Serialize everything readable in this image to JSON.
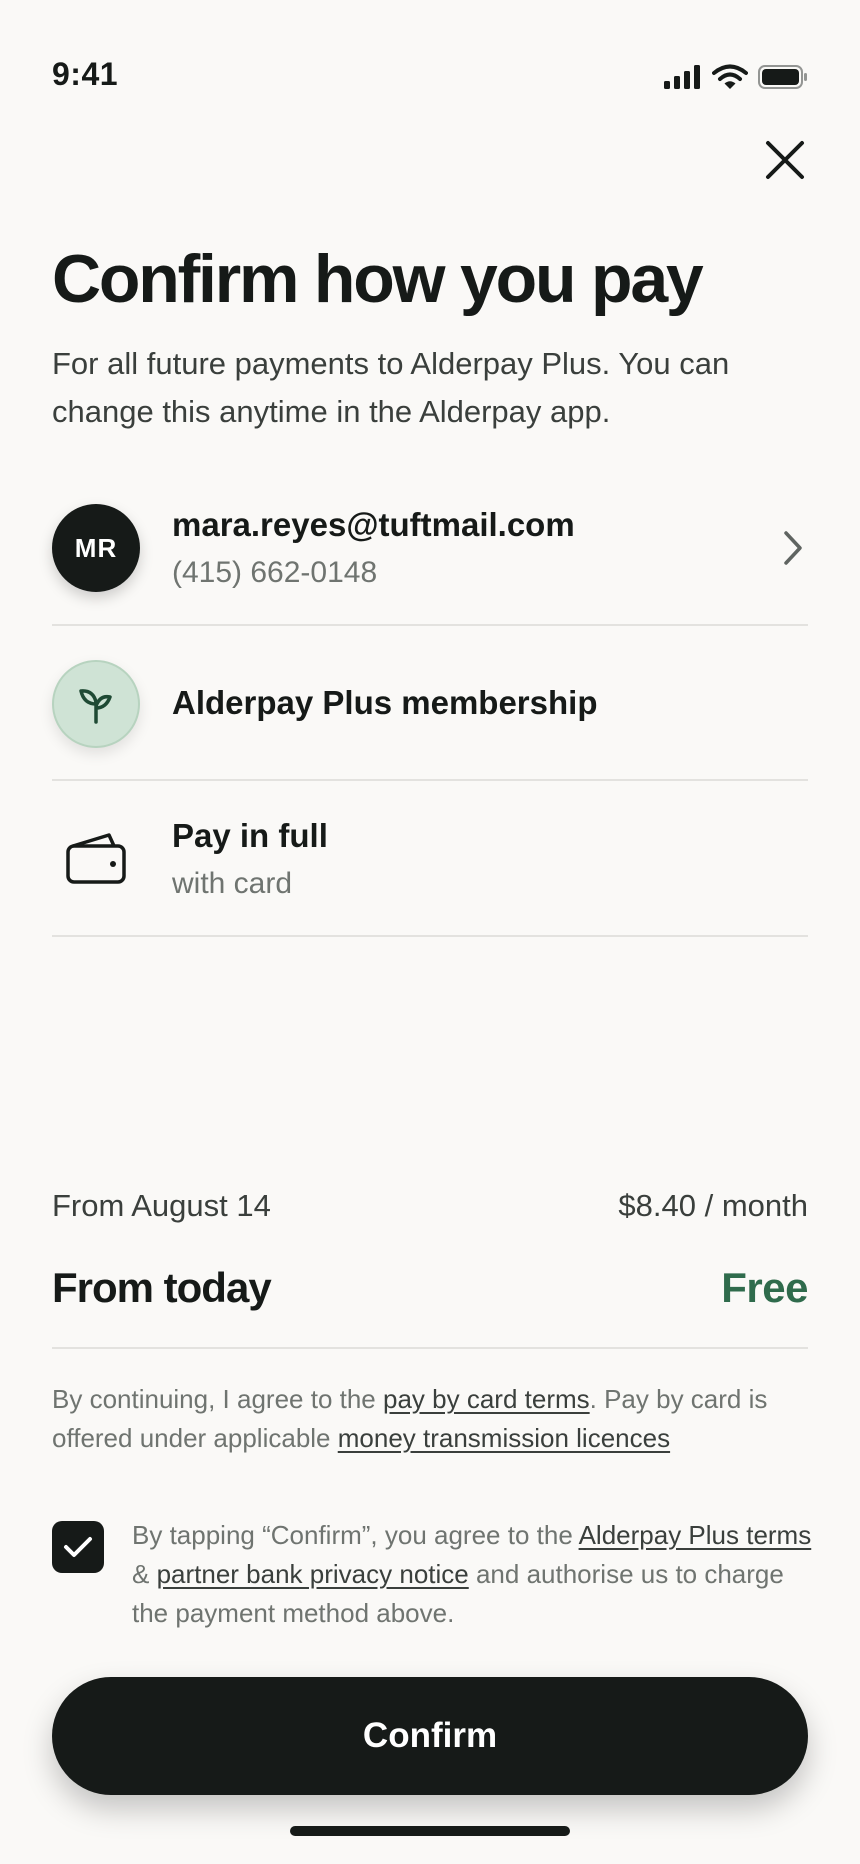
{
  "status_bar": {
    "time": "9:41"
  },
  "header": {
    "title": "Confirm how you pay",
    "subtitle": "For all future payments to Alderpay Plus. You can change this anytime in the Alderpay app."
  },
  "account": {
    "initials": "MR",
    "email": "mara.reyes@tuftmail.com",
    "phone": "(415) 662-0148"
  },
  "membership": {
    "label": "Alderpay Plus membership"
  },
  "payment_method": {
    "title": "Pay in full",
    "subtitle": "with card"
  },
  "pricing": {
    "future_label": "From August 14",
    "future_price": "$8.40 / month",
    "today_label": "From today",
    "today_price": "Free"
  },
  "legal": {
    "part1": "By continuing, I agree to the ",
    "link1": "pay by card terms",
    "part2": ". Pay by card is offered under applicable ",
    "link2": "money transmission licences"
  },
  "consent": {
    "checked": true,
    "part1": "By tapping “Confirm”, you agree to the ",
    "link1": "Alderpay Plus terms",
    "part2": " & ",
    "link2": "partner bank privacy notice",
    "part3": " and authorise us to charge the payment method above."
  },
  "confirm_button": {
    "label": "Confirm"
  },
  "colors": {
    "background": "#faf9f7",
    "primary": "#161a18",
    "accent_green": "#2f6b4c",
    "membership_badge": "#cfe3d5",
    "muted_text": "#6f7470"
  },
  "icons": {
    "close": "close-icon",
    "chevron": "chevron-right-icon",
    "membership": "sprout-icon",
    "payment": "wallet-icon",
    "checkbox": "checkmark-icon"
  }
}
